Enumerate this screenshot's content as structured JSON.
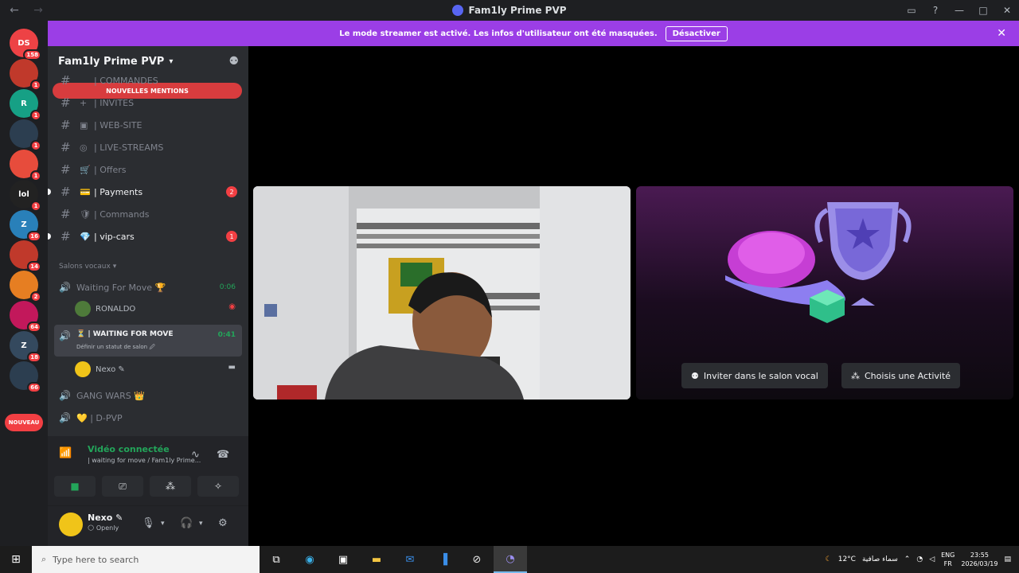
{
  "window": {
    "title": "Fam1ly Prime PVP",
    "back_icon": "←",
    "forward_icon": "→",
    "controls": [
      "inbox-icon",
      "help-icon",
      "minimize-icon",
      "maximize-icon",
      "close-icon"
    ]
  },
  "rail": {
    "servers": [
      {
        "label": "DS",
        "color": "#ed4245",
        "badge": "158"
      },
      {
        "label": "",
        "color": "#c0392b",
        "badge": "1"
      },
      {
        "label": "R",
        "color": "#16a085",
        "badge": "1"
      },
      {
        "label": "",
        "color": "#2c3e50",
        "badge": "1"
      },
      {
        "label": "",
        "color": "#e74c3c",
        "badge": "1"
      },
      {
        "label": "lol",
        "color": "#222222",
        "badge": "1"
      },
      {
        "label": "Z",
        "color": "#2980b9",
        "badge": "16"
      },
      {
        "label": "",
        "color": "#c0392b",
        "badge": "14"
      },
      {
        "label": "",
        "color": "#e67e22",
        "badge": "2"
      },
      {
        "label": "",
        "color": "#c2185b",
        "badge": "64"
      },
      {
        "label": "Z",
        "color": "#34495e",
        "badge": "18"
      },
      {
        "label": "",
        "color": "#2c3e50",
        "badge": "66"
      }
    ],
    "new_label": "NOUVEAU"
  },
  "banner": {
    "text": "Le mode streamer est activé. Les infos d'utilisateur ont été masquées.",
    "button": "Désactiver",
    "close": "✕"
  },
  "server": {
    "name": "Fam1ly Prime PVP",
    "mentions": "NOUVELLES MENTIONS",
    "channels": [
      {
        "emoji": "",
        "name": "| COMMANDES",
        "unread": false,
        "badge": ""
      },
      {
        "emoji": "+",
        "name": "| INVITES",
        "unread": false,
        "badge": ""
      },
      {
        "emoji": "▣",
        "name": "| WEB-SITE",
        "unread": false,
        "badge": ""
      },
      {
        "emoji": "◎",
        "name": "| LIVE-STREAMS",
        "unread": false,
        "badge": ""
      },
      {
        "emoji": "🛒",
        "name": "| Offers",
        "unread": false,
        "badge": ""
      },
      {
        "emoji": "💳",
        "name": "| Payments",
        "unread": true,
        "badge": "2"
      },
      {
        "emoji": "🛡",
        "name": "| Commands",
        "unread": false,
        "badge": ""
      },
      {
        "emoji": "💎",
        "name": "| vip-cars",
        "unread": true,
        "badge": "1"
      }
    ],
    "voice_category": "Salons vocaux",
    "voice_channels": [
      {
        "name": "Waiting For Move 🏆",
        "timer": "0:06"
      },
      {
        "name": "⏳ | WAITING FOR MOVE",
        "timer": "0:41",
        "sub": "Définir un statut de salon 🖉"
      },
      {
        "name": "GANG WARS 👑",
        "timer": ""
      },
      {
        "name": "💛 | D-PVP",
        "timer": ""
      }
    ],
    "members": [
      {
        "name": "RONALDO"
      },
      {
        "name": "Nexo ✎"
      }
    ]
  },
  "voice_panel": {
    "title": "Vidéo connectée",
    "subtitle": "| waiting for move / Fam1ly Prime...",
    "buttons": [
      "video-icon",
      "screen-share-icon",
      "activities-icon",
      "soundboard-icon"
    ]
  },
  "user": {
    "name": "Nexo ✎",
    "status": "🌕 Openly"
  },
  "stage": {
    "invite_label": "Inviter dans le salon vocal",
    "activity_label": "Choisis une Activité"
  },
  "taskbar": {
    "search_placeholder": "Type here to search",
    "weather": "12°C",
    "weather_desc": "سماء صافية",
    "lang_top": "ENG",
    "lang_bottom": "FR",
    "time": "23:55",
    "date": "2026/03/19"
  }
}
